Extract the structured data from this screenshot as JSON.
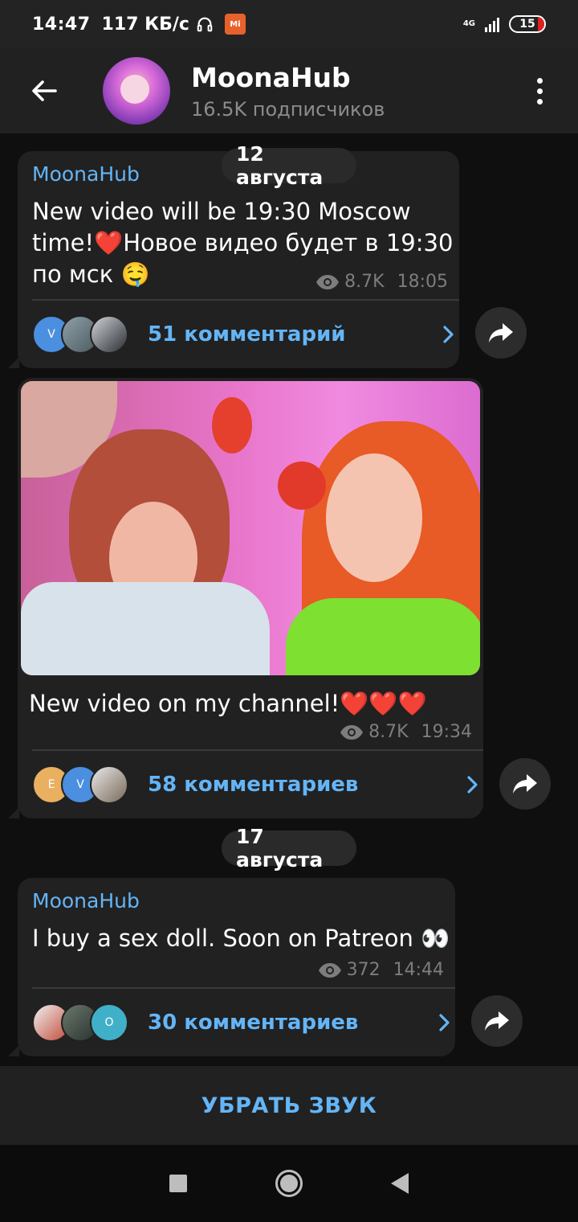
{
  "status_bar": {
    "time": "14:47",
    "speed": "117 КБ/с",
    "mi_label": "Mi",
    "network": "4G",
    "battery": "15",
    "battery_color": "#e02020"
  },
  "header": {
    "title": "MoonaHub",
    "subtitle": "16.5K подписчиков",
    "back_icon": "arrow-left-icon",
    "menu_icon": "more-vertical-icon"
  },
  "dates": [
    "12 августа",
    "17 августа"
  ],
  "posts": [
    {
      "author": "MoonaHub",
      "text_line1": "New video will be 19:30 Moscow",
      "text_line2": "time!❤️Новое видео будет в 19:30",
      "text_line3": "по мск 🤤",
      "views": "8.7K",
      "time": "18:05",
      "comments": "51 комментарий",
      "commenter_initials": [
        "V",
        "",
        ""
      ]
    },
    {
      "caption": "New video on my channel!❤️❤️❤️",
      "views": "8.7K",
      "time": "19:34",
      "comments": "58 комментариев",
      "commenter_initials": [
        "E",
        "V",
        ""
      ]
    },
    {
      "author": "MoonaHub",
      "text": "I buy a sex doll. Soon on Patreon 👀",
      "views": "372",
      "time": "14:44",
      "comments": "30 комментариев",
      "commenter_initials": [
        "",
        "",
        "O"
      ]
    }
  ],
  "mute_button": "УБРАТЬ ЗВУК",
  "colors": {
    "accent": "#64b5f6",
    "bubble": "#212121",
    "background": "#0f0f0f"
  }
}
